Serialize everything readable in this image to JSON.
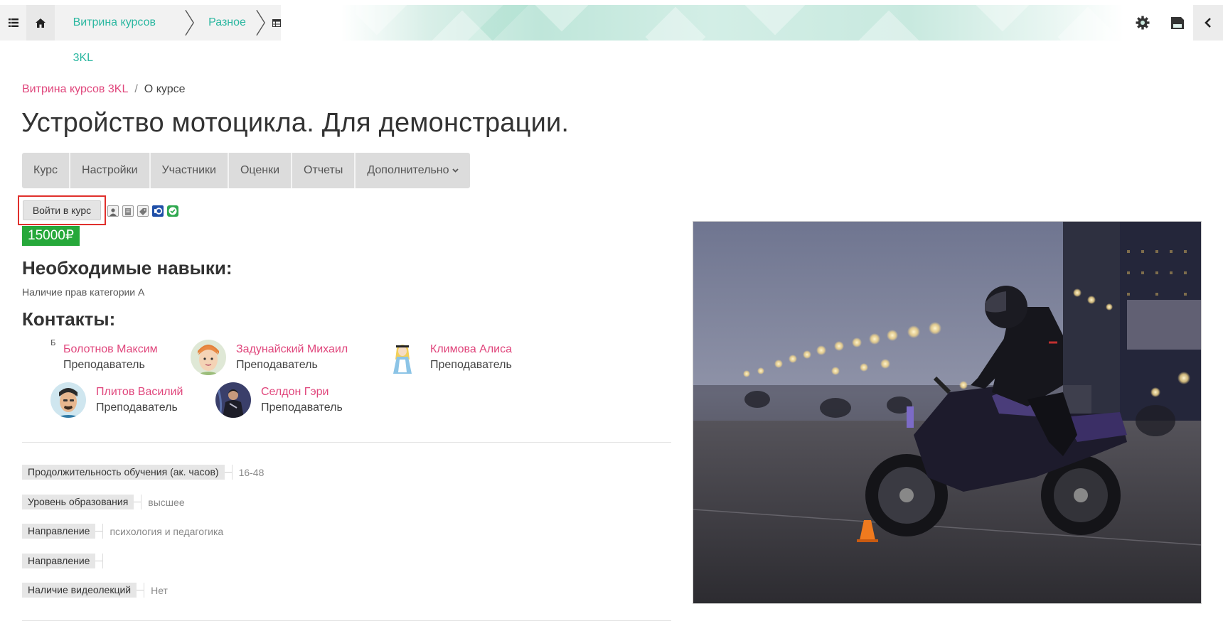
{
  "topbar": {
    "crumbs": [
      "Витрина курсов 3KL",
      "Разное"
    ],
    "icons": [
      "list-icon",
      "home-icon",
      "table-icon",
      "gear-icon",
      "save-icon",
      "chevron-left-icon"
    ]
  },
  "breadcrumb": {
    "root": "Витрина курсов 3KL",
    "separator": "/",
    "current": "О курсе"
  },
  "page_title": "Устройство мотоцикла. Для демонстрации.",
  "nav": {
    "tabs": [
      "Курс",
      "Настройки",
      "Участники",
      "Оценки",
      "Отчеты",
      "Дополнительно"
    ]
  },
  "enrol": {
    "button_label": "Войти в курс",
    "price": "15000₽",
    "icons": [
      "user-icon",
      "document-icon",
      "tag-icon",
      "yookassa-icon",
      "checkmark-icon"
    ]
  },
  "skills": {
    "heading": "Необходимые навыки:",
    "text": "Наличие прав категории А"
  },
  "contacts": {
    "heading": "Контакты:",
    "broken_avatar_alt": "Б",
    "people": [
      {
        "name": "Болотнов Максим",
        "role": "Преподаватель"
      },
      {
        "name": "Задунайский Михаил",
        "role": "Преподаватель"
      },
      {
        "name": "Климова Алиса",
        "role": "Преподаватель"
      },
      {
        "name": "Плитов Василий",
        "role": "Преподаватель"
      },
      {
        "name": "Селдон Гэри",
        "role": "Преподаватель"
      }
    ]
  },
  "fields": [
    {
      "key": "Продолжительность обучения (ак. часов)",
      "value": "16-48"
    },
    {
      "key": "Уровень образования",
      "value": "высшее"
    },
    {
      "key": "Направление",
      "value": "психология и педагогика"
    },
    {
      "key": "Направление",
      "value": ""
    },
    {
      "key": "Наличие видеолекций",
      "value": "Нет"
    }
  ],
  "colors": {
    "accent_link": "#e0467c",
    "topbar_link": "#2ab7a0",
    "price_bg": "#26a83a",
    "enrol_highlight": "#e0302c"
  }
}
